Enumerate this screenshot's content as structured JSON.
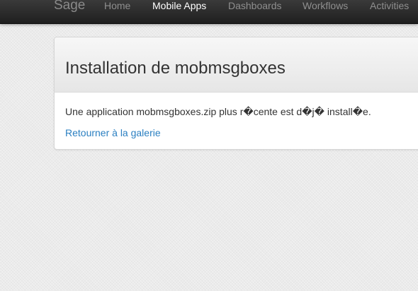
{
  "navbar": {
    "brand": "Sage",
    "items": [
      {
        "label": "Home",
        "active": false
      },
      {
        "label": "Mobile Apps",
        "active": true
      },
      {
        "label": "Dashboards",
        "active": false
      },
      {
        "label": "Workflows",
        "active": false
      },
      {
        "label": "Activities",
        "active": false
      }
    ]
  },
  "panel": {
    "title": "Installation de mobmsgboxes",
    "message": "Une application mobmsgboxes.zip plus r�cente est d�j� install�e.",
    "back_link": "Retourner à la galerie"
  },
  "colors": {
    "navbar_bg": "#2b2b2b",
    "nav_text": "#8f8f8f",
    "nav_active": "#ffffff",
    "link": "#2a7fc1",
    "page_bg": "#ebebeb"
  }
}
